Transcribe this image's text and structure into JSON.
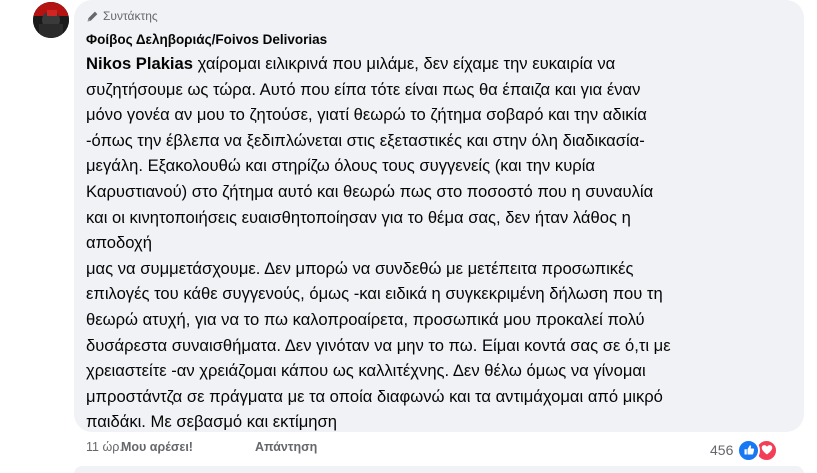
{
  "comment": {
    "author_badge": "Συντάκτης",
    "author_name": "Φοίβος Δεληβοριάς/Foivos Delivorias",
    "mention": "Nikos Plakias",
    "lines": [
      " χαίρομαι ειλικρινά που μιλάμε, δεν είχαμε την ευκαιρία να",
      "συζητήσουμε ως τώρα. Αυτό που είπα τότε είναι πως θα έπαιζα και για έναν",
      "μόνο γονέα αν μου το ζητούσε, γιατί θεωρώ το ζήτημα σοβαρό και την αδικία",
      "-όπως την έβλεπα να ξεδιπλώνεται στις εξεταστικές και στην όλη διαδικασία-",
      "μεγάλη. Εξακολουθώ και στηρίζω όλους τους συγγενείς (και την κυρία",
      "Καρυστιανού) στο ζήτημα αυτό και θεωρώ πως στο ποσοστό που η συναυλία",
      "και οι κινητοποιήσεις ευαισθητοποίησαν για το θέμα σας, δεν ήταν λάθος η",
      "αποδοχή",
      "μας να συμμετάσχουμε. Δεν μπορώ να συνδεθώ με μετέπειτα προσωπικές",
      "επιλογές του κάθε συγγενούς, όμως -και ειδικά η συγκεκριμένη δήλωση που τη",
      "θεωρώ ατυχή, για να το πω καλοπροαίρετα, προσωπικά μου προκαλεί πολύ",
      "δυσάρεστα συναισθήματα. Δεν γινόταν να μην το πω. Είμαι κοντά σας σε ό,τι με",
      "χρειαστείτε -αν χρειάζομαι κάπου ως καλλιτέχνης. Δεν θέλω όμως να γίνομαι",
      "μπροστάντζα σε πράγματα με τα οποία διαφωνώ και τα αντιμάχομαι από μικρό",
      "παιδάκι. Με σεβασμό και εκτίμηση"
    ],
    "time": "11 ώρ.",
    "like_label": "Μου αρέσει!",
    "reply_label": "Απάντηση",
    "reaction_count": "456",
    "reaction_icons": [
      "like-icon",
      "love-icon"
    ],
    "colors": {
      "bubble_bg": "#f0f2f5",
      "secondary_text": "#65676b",
      "like_blue": "#1877f2",
      "love_red": "#f33e58"
    }
  }
}
